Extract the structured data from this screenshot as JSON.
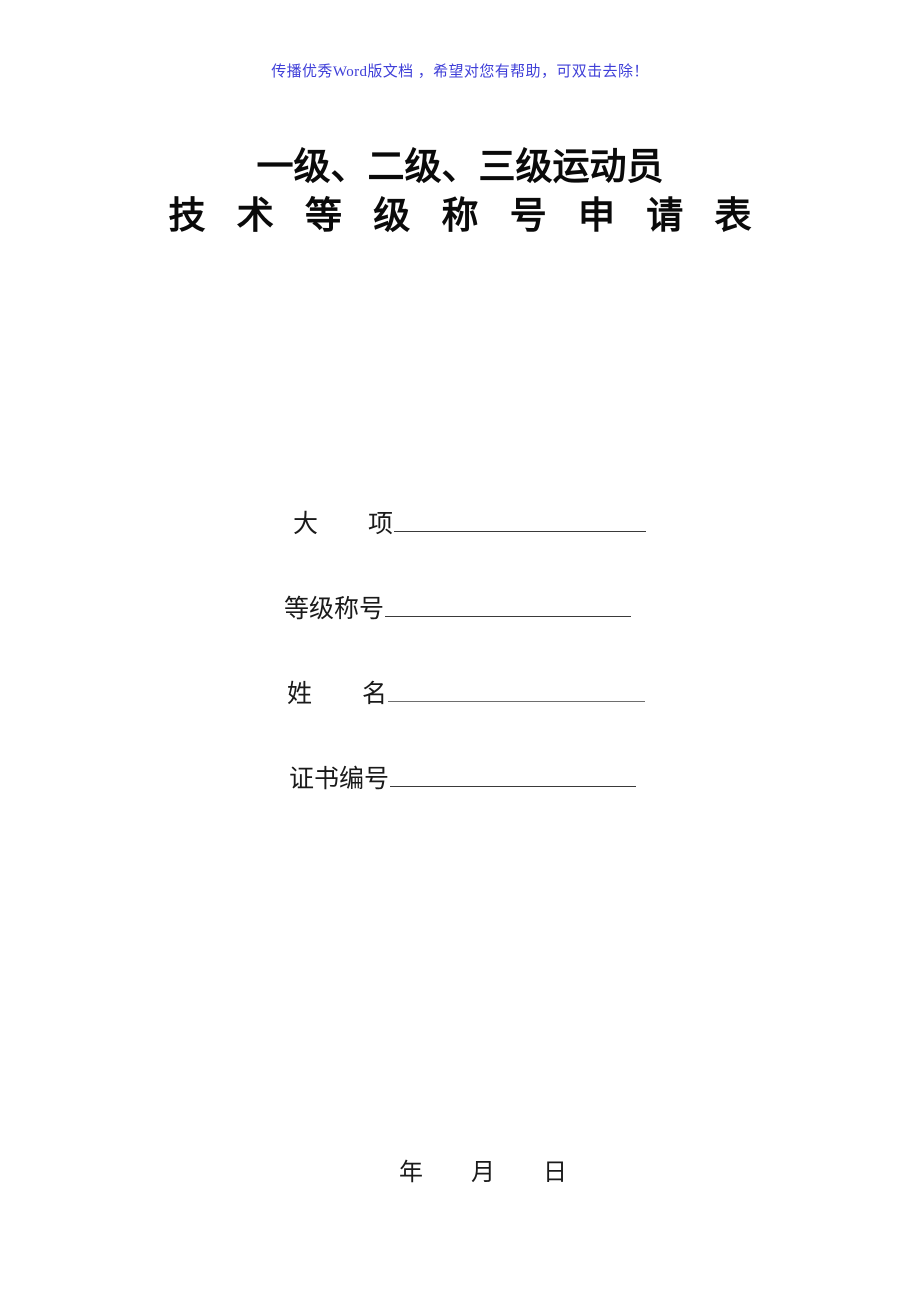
{
  "document": {
    "watermark": "传播优秀Word版文档 ，希望对您有帮助，可双击去除！",
    "watermark_color": "#3f3fd8",
    "title_line_1": "一级、二级、三级运动员",
    "title_line_2": "技 术 等 级 称 号 申 请 表",
    "text_color": "#1a1a1a",
    "rule_color": "#3a3a3a",
    "background_color": "#ffffff"
  },
  "fields": [
    {
      "label": "大　　项",
      "value": ""
    },
    {
      "label": "等级称号",
      "value": ""
    },
    {
      "label": "姓　　名",
      "value": ""
    },
    {
      "label": "证书编号",
      "value": ""
    }
  ],
  "footer": {
    "date_line": "年　　月　　日"
  }
}
